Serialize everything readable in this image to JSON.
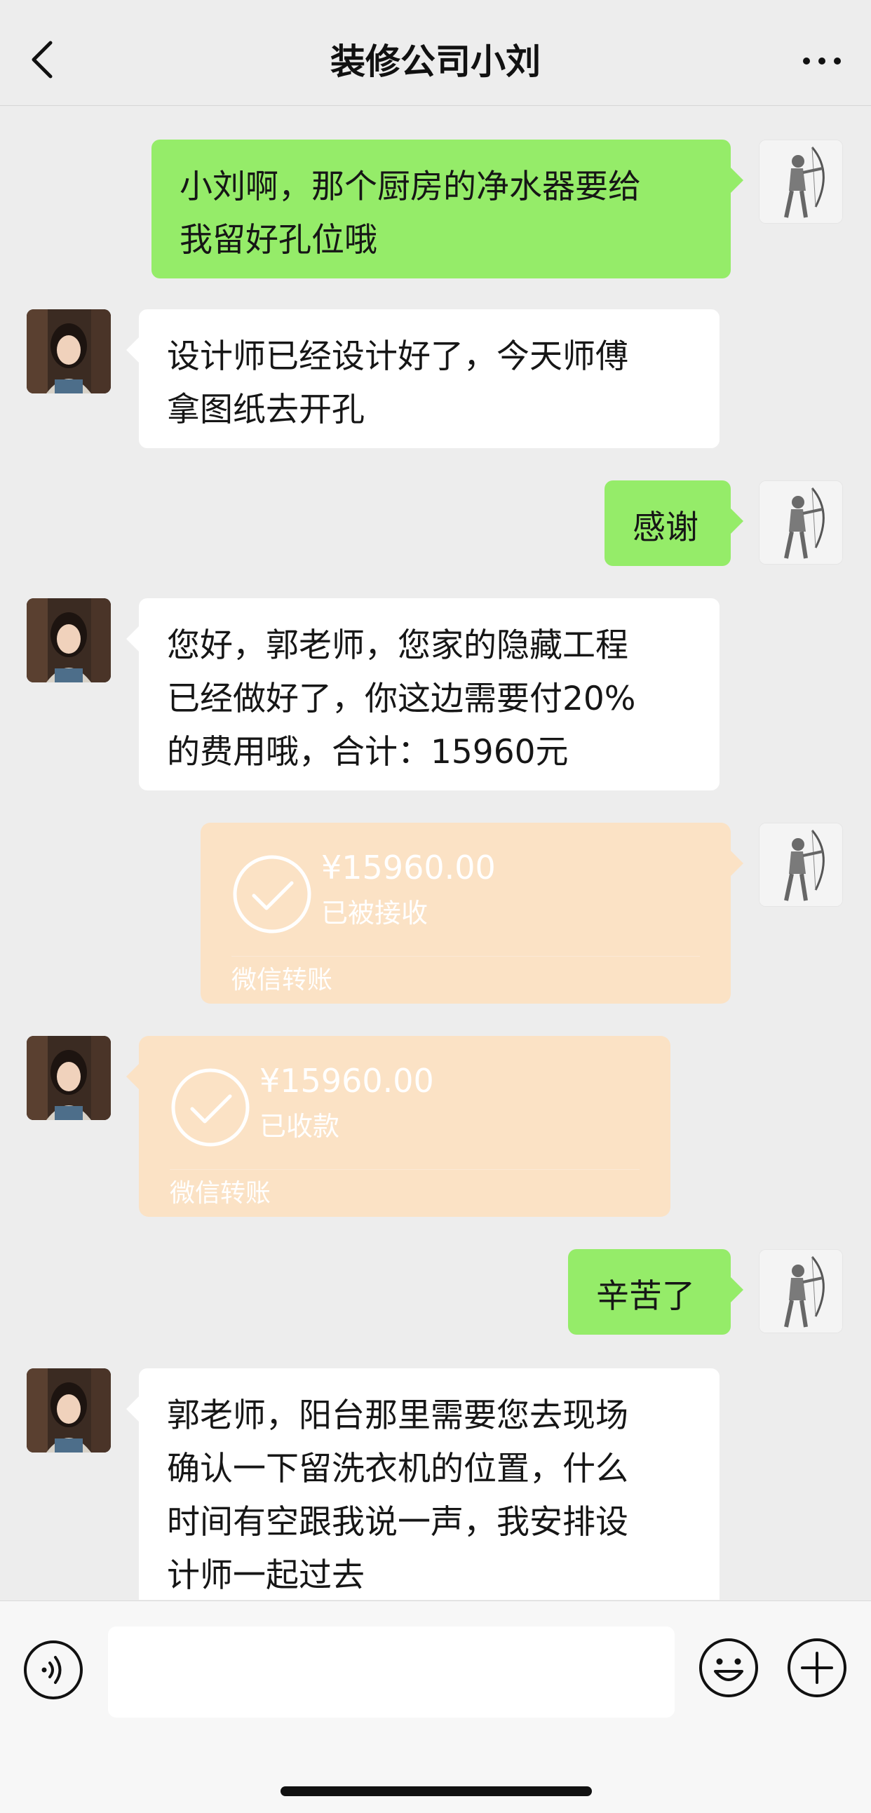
{
  "header": {
    "title": "装修公司小刘"
  },
  "messages": [
    {
      "from": "self",
      "type": "text",
      "text": "小刘啊，那个厨房的净水器要给\n我留好孔位哦"
    },
    {
      "from": "other",
      "type": "text",
      "text": "设计师已经设计好了，今天师傅\n拿图纸去开孔"
    },
    {
      "from": "self",
      "type": "text",
      "text": "感谢"
    },
    {
      "from": "other",
      "type": "text",
      "text": "您好，郭老师，您家的隐藏工程\n已经做好了，你这边需要付20%\n的费用哦，合计：15960元"
    },
    {
      "from": "self",
      "type": "transfer",
      "amount": "¥15960.00",
      "status": "已被接收",
      "label": "微信转账"
    },
    {
      "from": "other",
      "type": "transfer",
      "amount": "¥15960.00",
      "status": "已收款",
      "label": "微信转账"
    },
    {
      "from": "self",
      "type": "text",
      "text": "辛苦了"
    },
    {
      "from": "other",
      "type": "text",
      "text": "郭老师，阳台那里需要您去现场\n确认一下留洗衣机的位置，什么\n时间有空跟我说一声，我安排设\n计师一起过去"
    }
  ],
  "colors": {
    "self_bubble": "#95ec69",
    "other_bubble": "#ffffff",
    "transfer_bubble": "#fbe2c5",
    "background": "#ededed"
  },
  "icons": {
    "back": "chevron-left-icon",
    "more": "more-dots-icon",
    "voice": "voice-icon",
    "emoji": "emoji-icon",
    "plus": "plus-icon",
    "check": "check-circle-icon"
  }
}
